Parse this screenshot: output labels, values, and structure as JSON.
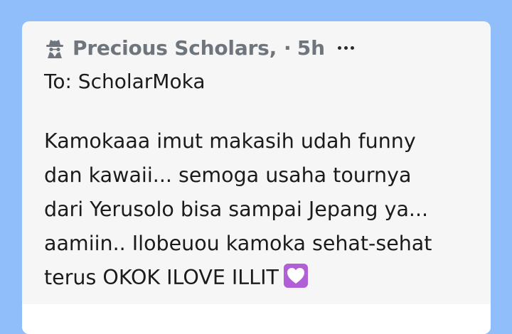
{
  "post": {
    "sender": "Precious Scholars,",
    "separator": "·",
    "time": "5h",
    "recipient": "To: ScholarMoka",
    "message_lines": [
      "Kamokaaa imut makasih udah funny",
      "dan kawaii... semoga usaha tournya",
      "dari Yerusolo bisa sampai Jepang ya...",
      "aamiin.. Ilobeuou kamoka sehat-sehat",
      "terus OKOK ILOVE ILLIT"
    ],
    "icons": {
      "avatar": "spy-incognito-icon",
      "menu": "more-horizontal-icon",
      "emoji": "heart-emoji-icon"
    }
  },
  "colors": {
    "background": "#8fbefb",
    "card": "#f6f6f6",
    "meta_text": "#6f757d",
    "body_text": "#1b1b1b",
    "heart": "#b05fd6"
  }
}
